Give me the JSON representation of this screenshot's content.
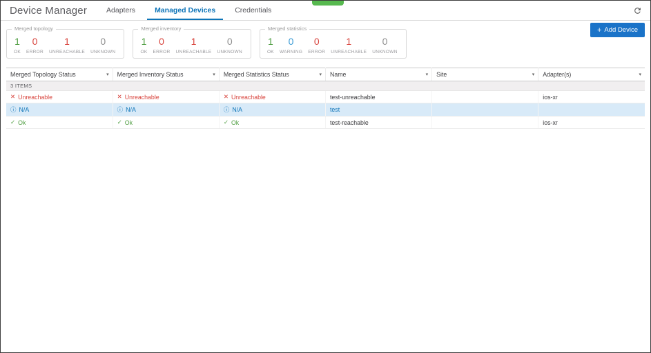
{
  "header": {
    "title": "Device Manager",
    "tabs": [
      {
        "label": "Adapters"
      },
      {
        "label": "Managed Devices"
      },
      {
        "label": "Credentials"
      }
    ]
  },
  "toolbar": {
    "add_device_label": "Add Device"
  },
  "stat_cards": [
    {
      "title": "Merged topology",
      "stats": [
        {
          "label": "OK",
          "value": "1",
          "status": "ok"
        },
        {
          "label": "ERROR",
          "value": "0",
          "status": "error"
        },
        {
          "label": "UNREACHABLE",
          "value": "1",
          "status": "unreachable"
        },
        {
          "label": "UNKNOWN",
          "value": "0",
          "status": "unknown"
        }
      ]
    },
    {
      "title": "Merged inventory",
      "stats": [
        {
          "label": "OK",
          "value": "1",
          "status": "ok"
        },
        {
          "label": "ERROR",
          "value": "0",
          "status": "error"
        },
        {
          "label": "UNREACHABLE",
          "value": "1",
          "status": "unreachable"
        },
        {
          "label": "UNKNOWN",
          "value": "0",
          "status": "unknown"
        }
      ]
    },
    {
      "title": "Merged statistics",
      "stats": [
        {
          "label": "OK",
          "value": "1",
          "status": "ok"
        },
        {
          "label": "WARNING",
          "value": "0",
          "status": "warning"
        },
        {
          "label": "ERROR",
          "value": "0",
          "status": "error"
        },
        {
          "label": "UNREACHABLE",
          "value": "1",
          "status": "unreachable"
        },
        {
          "label": "UNKNOWN",
          "value": "0",
          "status": "unknown"
        }
      ]
    }
  ],
  "table": {
    "columns": [
      {
        "label": "Merged Topology Status"
      },
      {
        "label": "Merged Inventory Status"
      },
      {
        "label": "Merged Statistics Status"
      },
      {
        "label": "Name"
      },
      {
        "label": "Site"
      },
      {
        "label": "Adapter(s)"
      }
    ],
    "items_count_label": "3 ITEMS",
    "rows": [
      {
        "topology": "Unreachable",
        "inventory": "Unreachable",
        "statistics": "Unreachable",
        "name": "test-unreachable",
        "site": "",
        "adapters": "ios-xr",
        "status_type": "unreachable"
      },
      {
        "topology": "N/A",
        "inventory": "N/A",
        "statistics": "N/A",
        "name": "test",
        "site": "",
        "adapters": "",
        "status_type": "na",
        "selected": true
      },
      {
        "topology": "Ok",
        "inventory": "Ok",
        "statistics": "Ok",
        "name": "test-reachable",
        "site": "",
        "adapters": "ios-xr",
        "status_type": "ok"
      }
    ]
  },
  "icons": {
    "refresh": "refresh-icon",
    "caret": "▾",
    "plus": "+",
    "unreachable": "✕",
    "na": "ⓘ",
    "ok": "✓"
  },
  "colors": {
    "accent_blue": "#0d74b8",
    "button_blue": "#1a73c8",
    "ok_green": "#4f9e42",
    "error_red": "#d8453e",
    "warning_blue": "#3a9bd5",
    "unknown_gray": "#8f8f8f",
    "selected_row": "#d8eaf8",
    "toast_green": "#57b94f"
  }
}
